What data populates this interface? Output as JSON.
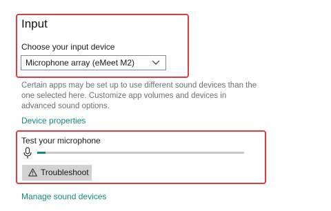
{
  "input_section": {
    "title": "Input",
    "choose_label": "Choose your input device",
    "selected_device": "Microphone array (eMeet M2)",
    "description": "Certain apps may be set up to use different sound devices than the one selected here. Customize app volumes and devices in advanced sound options.",
    "device_properties_link": "Device properties"
  },
  "test_section": {
    "label": "Test your microphone",
    "level_fraction": 0.04,
    "troubleshoot_label": "Troubleshoot"
  },
  "manage_sound_devices_link": "Manage sound devices",
  "colors": {
    "highlight": "#e0393f",
    "link": "#0d8a83",
    "meter_fill": "#0d8a83",
    "button_bg": "#d2d2d2"
  },
  "icons": {
    "dropdown": "chevron-down-icon",
    "microphone": "microphone-icon",
    "troubleshoot": "warning-icon"
  }
}
